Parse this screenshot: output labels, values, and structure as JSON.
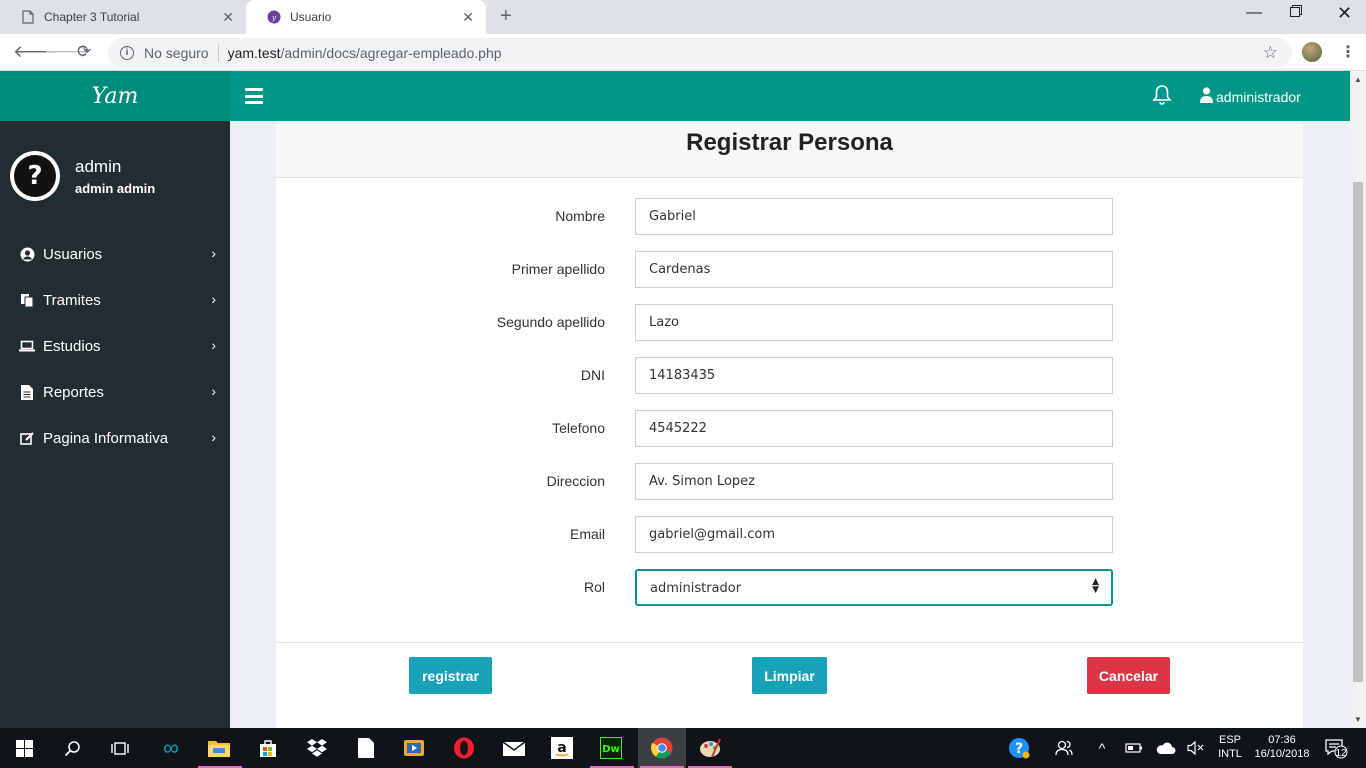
{
  "browser": {
    "tabs": [
      {
        "title": "Chapter 3 Tutorial",
        "active": false
      },
      {
        "title": "Usuario",
        "active": true
      }
    ],
    "security_label": "No seguro",
    "url_host": "yam.test",
    "url_path": "/admin/docs/agregar-empleado.php"
  },
  "app": {
    "logo": "Yam",
    "top_user": "administrador"
  },
  "sidebar": {
    "user_name": "admin",
    "user_full": "admin admin",
    "items": [
      {
        "label": "Usuarios",
        "icon": "user-circle-icon"
      },
      {
        "label": "Tramites",
        "icon": "copy-icon"
      },
      {
        "label": "Estudios",
        "icon": "laptop-icon"
      },
      {
        "label": "Reportes",
        "icon": "file-text-icon"
      },
      {
        "label": "Pagina Informativa",
        "icon": "edit-icon"
      }
    ]
  },
  "form": {
    "title": "Registrar Persona",
    "fields": [
      {
        "label": "Nombre",
        "value": "Gabriel"
      },
      {
        "label": "Primer apellido",
        "value": "Cardenas"
      },
      {
        "label": "Segundo apellido",
        "value": "Lazo"
      },
      {
        "label": "DNI",
        "value": "14183435"
      },
      {
        "label": "Telefono",
        "value": "4545222"
      },
      {
        "label": "Direccion",
        "value": "Av. Simon Lopez"
      },
      {
        "label": "Email",
        "value": "gabriel@gmail.com"
      },
      {
        "label": "Rol",
        "value": "administrador"
      }
    ],
    "buttons": {
      "register": "registrar",
      "clear": "Limpiar",
      "cancel": "Cancelar"
    }
  },
  "taskbar": {
    "lang_top": "ESP",
    "lang_bottom": "INTL",
    "time": "07:36",
    "date": "16/10/2018",
    "notifications": "12"
  },
  "colors": {
    "header_teal": "#009688",
    "logo_teal": "#008d7c",
    "sidebar_dark": "#222d32",
    "button_teal": "#17a2b8",
    "button_red": "#dc3545"
  }
}
